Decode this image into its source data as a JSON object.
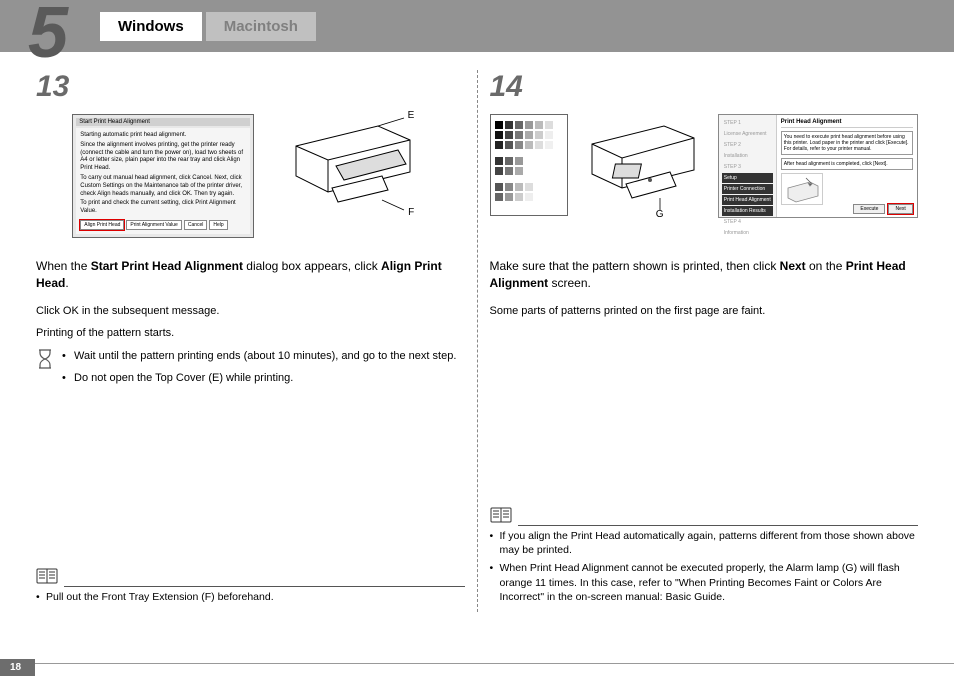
{
  "header": {
    "chapter": "5",
    "tab_windows": "Windows",
    "tab_macintosh": "Macintosh"
  },
  "left": {
    "step": "13",
    "dialog": {
      "title": "Start Print Head Alignment",
      "body1": "Starting automatic print head alignment.",
      "body2": "Since the alignment involves printing, get the printer ready (connect the cable and turn the power on), load two sheets of A4 or letter size, plain paper into the rear tray and click Align Print Head.",
      "body3": "To carry out manual head alignment, click Cancel. Next, click Custom Settings on the Maintenance tab of the printer driver, check Align heads manually, and click OK. Then try again.",
      "body4": "To print and check the current setting, click Print Alignment Value.",
      "btn_align": "Align Print Head",
      "btn_value": "Print Alignment Value",
      "btn_cancel": "Cancel",
      "btn_help": "Help"
    },
    "callout_E": "E",
    "callout_F": "F",
    "instruction_pre": "When the ",
    "instruction_bold1": "Start Print Head Alignment",
    "instruction_mid": " dialog box appears, click ",
    "instruction_bold2": "Align Print Head",
    "instruction_post": ".",
    "sub1_pre": "Click ",
    "sub1_bold": "OK",
    "sub1_post": " in the subsequent message.",
    "sub2": "Printing of the pattern starts.",
    "note1": "Wait until the pattern printing ends (about 10 minutes), and go to the next step.",
    "note2": "Do not open the Top Cover (E) while printing.",
    "ref1": "Pull out the Front Tray Extension (F) beforehand."
  },
  "right": {
    "step": "14",
    "setup": {
      "nav_step1": "STEP 1",
      "nav_item1": "License Agreement",
      "nav_step2": "STEP 2",
      "nav_item2": "Installation",
      "nav_step3": "STEP 3",
      "nav_item3": "Setup",
      "nav_sub1": "Printer Connection",
      "nav_sub2": "Print Head Alignment",
      "nav_sub3": "Installation Results",
      "nav_step4": "STEP 4",
      "nav_item4": "Information",
      "title": "Print Head Alignment",
      "msg1": "You need to execute print head alignment before using this printer. Load paper in the printer and click [Execute]. For details, refer to your printer manual.",
      "msg2": "After head alignment is completed, click [Next].",
      "btn_execute": "Execute",
      "btn_next": "Next"
    },
    "callout_G": "G",
    "instruction_pre": "Make sure that the pattern shown is printed, then click ",
    "instruction_bold1": "Next",
    "instruction_mid": " on the ",
    "instruction_bold2": "Print Head Alignment",
    "instruction_post": " screen.",
    "sub1": "Some parts of patterns printed on the first page are faint.",
    "ref1": "If you align the Print Head automatically again, patterns different from those shown above may be printed.",
    "ref2_pre": "When Print Head Alignment cannot be executed properly, the ",
    "ref2_bold1": "Alarm",
    "ref2_mid": " lamp (G) will flash orange 11 times. In this case, refer to \"When Printing Becomes Faint or Colors Are Incorrect\" in the on-screen manual: ",
    "ref2_bold2": "Basic Guide",
    "ref2_post": "."
  },
  "footer": {
    "page": "18"
  }
}
